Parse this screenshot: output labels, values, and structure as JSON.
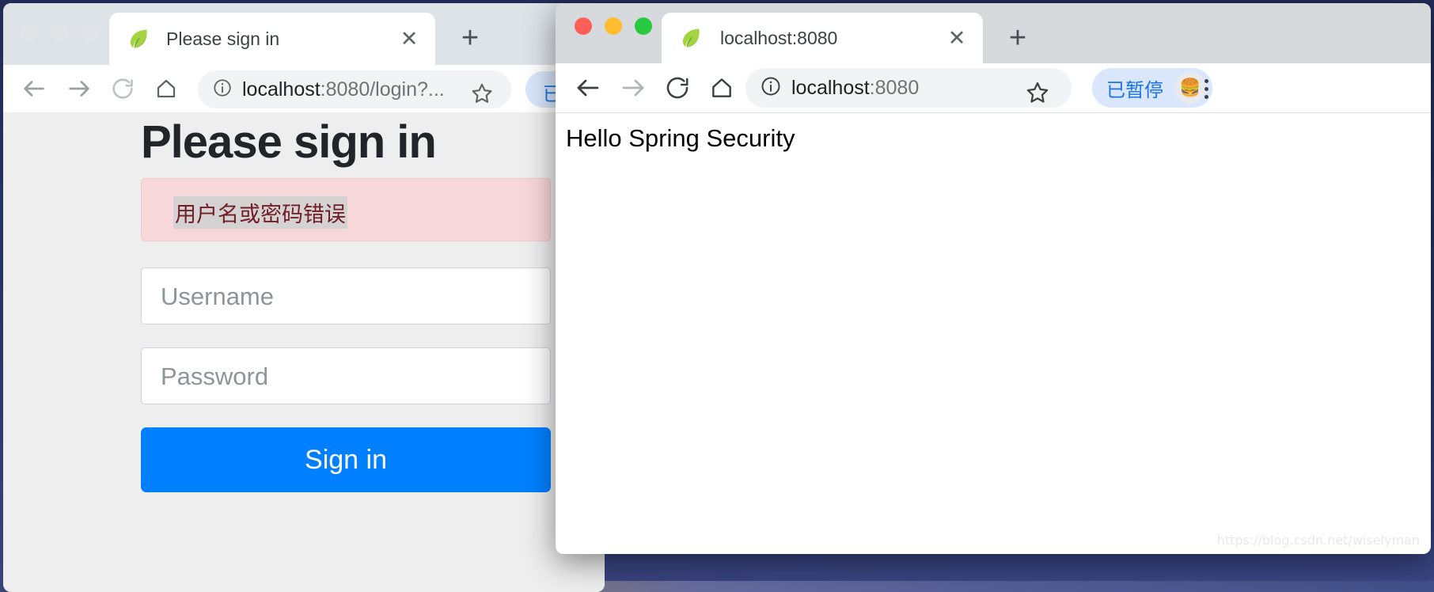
{
  "desktop": {
    "background_color": "#2b3466"
  },
  "windows": {
    "left": {
      "state": "inactive",
      "tab": {
        "title": "Please sign in",
        "favicon": "spring-leaf-icon",
        "close_label": "✕"
      },
      "new_tab_label": "+",
      "toolbar": {
        "back_icon": "back-arrow-icon",
        "forward_icon": "forward-arrow-icon",
        "reload_icon": "reload-icon",
        "home_icon": "home-icon",
        "info_icon": "site-info-icon",
        "url": "localhost:8080/login?...",
        "url_host": "localhost",
        "url_rest": ":8080/login?...",
        "star_icon": "bookmark-star-icon",
        "pause_label": "已暂"
      },
      "page": {
        "heading": "Please sign in",
        "alert": "用户名或密码错误",
        "alert_bg": "#f8d7da",
        "alert_color": "#721c24",
        "username_placeholder": "Username",
        "password_placeholder": "Password",
        "submit_label": "Sign in",
        "submit_color": "#007bff"
      }
    },
    "right": {
      "state": "active",
      "lights": [
        "#ff5f57",
        "#febc2e",
        "#28c840"
      ],
      "tab": {
        "title": "localhost:8080",
        "favicon": "spring-leaf-icon",
        "close_label": "✕"
      },
      "new_tab_label": "+",
      "toolbar": {
        "back_icon": "back-arrow-icon",
        "forward_icon": "forward-arrow-icon",
        "reload_icon": "reload-icon",
        "home_icon": "home-icon",
        "info_icon": "site-info-icon",
        "url_host": "localhost",
        "url_rest": ":8080",
        "star_icon": "bookmark-star-icon",
        "pause_label": "已暂停",
        "avatar_icon": "🍔",
        "menu_icon": "kebab-menu-icon"
      },
      "page": {
        "body_text": "Hello Spring Security",
        "watermark": "https://blog.csdn.net/wiselyman"
      }
    }
  }
}
